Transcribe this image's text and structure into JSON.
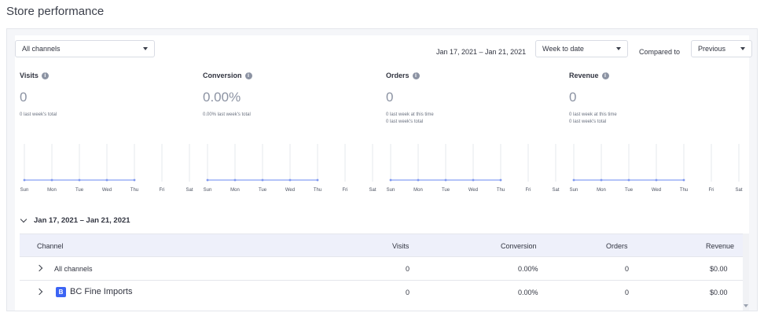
{
  "page": {
    "title": "Store performance"
  },
  "toolbar": {
    "channel_select": "All channels",
    "date_range": "Jan 17, 2021 – Jan 21, 2021",
    "period_select": "Week to date",
    "compared_label": "Compared to",
    "compared_select": "Previous"
  },
  "metrics": [
    {
      "label": "Visits",
      "value": "0",
      "sub1": "0 last week's total",
      "sub2": ""
    },
    {
      "label": "Conversion",
      "value": "0.00%",
      "sub1": "0.00% last week's total",
      "sub2": ""
    },
    {
      "label": "Orders",
      "value": "0",
      "sub1": "0 last week at this time",
      "sub2": "0 last week's total"
    },
    {
      "label": "Revenue",
      "value": "0",
      "sub1": "0 last week at this time",
      "sub2": "0 last week's total"
    }
  ],
  "chart_data": [
    {
      "type": "line",
      "x": [
        "Sun",
        "Mon",
        "Tue",
        "Wed",
        "Thu",
        "Fri",
        "Sat"
      ],
      "series": [
        {
          "values": [
            0,
            0,
            0,
            0,
            0
          ]
        }
      ]
    },
    {
      "type": "line",
      "x": [
        "Sun",
        "Mon",
        "Tue",
        "Wed",
        "Thu",
        "Fri",
        "Sat"
      ],
      "series": [
        {
          "values": [
            0,
            0,
            0,
            0,
            0
          ]
        }
      ]
    },
    {
      "type": "line",
      "x": [
        "Sun",
        "Mon",
        "Tue",
        "Wed",
        "Thu",
        "Fri",
        "Sat"
      ],
      "series": [
        {
          "values": [
            0,
            0,
            0,
            0,
            0
          ]
        }
      ]
    },
    {
      "type": "line",
      "x": [
        "Sun",
        "Mon",
        "Tue",
        "Wed",
        "Thu",
        "Fri",
        "Sat"
      ],
      "series": [
        {
          "values": [
            0,
            0,
            0,
            0,
            0
          ]
        }
      ]
    }
  ],
  "table": {
    "range": "Jan 17, 2021 – Jan 21, 2021",
    "headers": {
      "channel": "Channel",
      "visits": "Visits",
      "conversion": "Conversion",
      "orders": "Orders",
      "revenue": "Revenue"
    },
    "rows": [
      {
        "channel": "All channels",
        "visits": "0",
        "conversion": "0.00%",
        "orders": "0",
        "revenue": "$0.00"
      },
      {
        "channel": "BC Fine Imports",
        "visits": "0",
        "conversion": "0.00%",
        "orders": "0",
        "revenue": "$0.00",
        "icon": "store-icon"
      }
    ]
  },
  "colors": {
    "line": "#9bb0f5",
    "grid": "#e6e8ee",
    "accent": "#3c64f4"
  }
}
